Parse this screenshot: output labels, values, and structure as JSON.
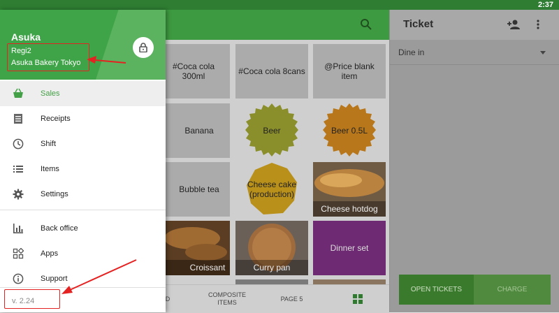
{
  "status_bar": {
    "time": "2:37"
  },
  "drawer": {
    "user_name": "Asuka",
    "pos_name": "Regi2",
    "store_name": "Asuka Bakery Tokyo",
    "version": "v. 2.24",
    "menu": [
      {
        "label": "Sales",
        "icon": "basket-icon"
      },
      {
        "label": "Receipts",
        "icon": "receipt-icon"
      },
      {
        "label": "Shift",
        "icon": "clock-icon"
      },
      {
        "label": "Items",
        "icon": "list-icon"
      },
      {
        "label": "Settings",
        "icon": "gear-icon"
      },
      {
        "label": "Back office",
        "icon": "bar-chart-icon"
      },
      {
        "label": "Apps",
        "icon": "apps-icon"
      },
      {
        "label": "Support",
        "icon": "info-icon"
      }
    ]
  },
  "items": [
    {
      "label": "#Coca cola 300ml"
    },
    {
      "label": "#Coca cola 8cans"
    },
    {
      "label": "@Price blank item"
    },
    {
      "label": "Banana"
    },
    {
      "label": "Beer"
    },
    {
      "label": "Beer 0.5L"
    },
    {
      "label": "Bubble tea"
    },
    {
      "label": "Cheese cake (production)"
    },
    {
      "label": "Cheese hotdog"
    },
    {
      "label": "Croissant"
    },
    {
      "label": "Curry pan"
    },
    {
      "label": "Dinner set"
    }
  ],
  "bottom_tabs": {
    "partial": "D",
    "composite": "COMPOSITE ITEMS",
    "page": "PAGE 5"
  },
  "ticket": {
    "title": "Ticket",
    "dining_option": "Dine in",
    "open_tickets": "OPEN TICKETS",
    "charge": "CHARGE"
  },
  "colors": {
    "brand_green": "#43a047",
    "annotation_red": "#e52222"
  }
}
